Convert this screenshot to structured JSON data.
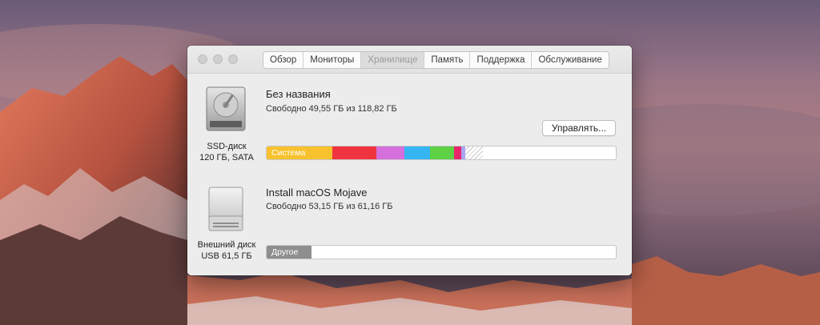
{
  "tabs": [
    {
      "label": "Обзор"
    },
    {
      "label": "Мониторы"
    },
    {
      "label": "Хранилище"
    },
    {
      "label": "Память"
    },
    {
      "label": "Поддержка"
    },
    {
      "label": "Обслуживание"
    }
  ],
  "active_tab": "Хранилище",
  "disks": [
    {
      "icon": "internal-hard-drive-icon",
      "caption_line1": "SSD-диск",
      "caption_line2": "120 ГБ, SATA",
      "name": "Без названия",
      "free_text": "Свободно 49,55 ГБ из 118,82 ГБ",
      "manage_label": "Управлять...",
      "segments": [
        {
          "label": "Система",
          "color": "#f7c22e",
          "fraction": 0.189
        },
        {
          "label": "",
          "color": "#f0343f",
          "fraction": 0.126
        },
        {
          "label": "",
          "color": "#d56fdc",
          "fraction": 0.08
        },
        {
          "label": "",
          "color": "#35b5f2",
          "fraction": 0.073
        },
        {
          "label": "",
          "color": "#5fd144",
          "fraction": 0.069
        },
        {
          "label": "",
          "color": "#e8256b",
          "fraction": 0.021
        },
        {
          "label": "",
          "color": "#a9a4f2",
          "fraction": 0.011
        },
        {
          "label": "",
          "color": "hatched",
          "fraction": 0.05
        }
      ]
    },
    {
      "icon": "external-usb-drive-icon",
      "caption_line1": "Внешний диск",
      "caption_line2": "USB 61,5 ГБ",
      "name": "Install macOS Mojave",
      "free_text": "Свободно 53,15 ГБ из 61,16 ГБ",
      "segments": [
        {
          "label": "Другое",
          "color": "#8e8e8e",
          "fraction": 0.129
        }
      ]
    }
  ]
}
